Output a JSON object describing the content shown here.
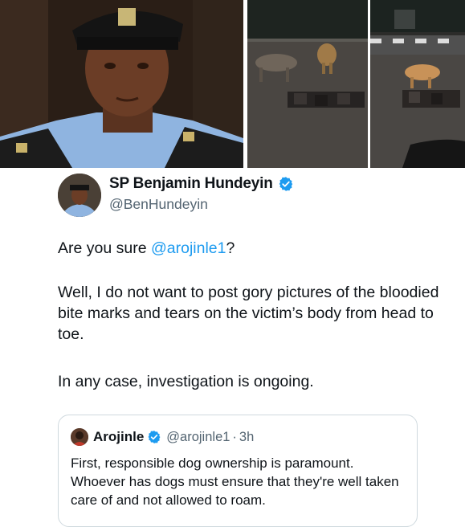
{
  "media": {
    "photos": [
      {
        "subject": "police-officer-portrait"
      },
      {
        "subject": "night-street-dogs"
      },
      {
        "subject": "night-street-dog-by-road"
      }
    ]
  },
  "tweet": {
    "author": {
      "display_name": "SP Benjamin Hundeyin",
      "handle": "@BenHundeyin",
      "verified": true,
      "verified_color": "#1d9bf0"
    },
    "body": {
      "para1_prefix": "Are you sure ",
      "para1_mention": "@arojinle1",
      "para1_suffix": "?",
      "para2": "Well, I do not want to post gory pictures of the bloodied bite marks and tears on the victim’s body from head to toe.",
      "para3": "In any case, investigation is ongoing."
    }
  },
  "quoted_tweet": {
    "author": {
      "display_name": "Arojinle",
      "handle": "@arojinle1",
      "verified": true
    },
    "separator": "·",
    "time": "3h",
    "text": "First, responsible dog ownership is paramount. Whoever has dogs must ensure that they're well taken care of and not allowed to roam."
  },
  "colors": {
    "link": "#1d9bf0",
    "text": "#0f1419",
    "muted": "#536471",
    "border": "#cfd9de"
  }
}
